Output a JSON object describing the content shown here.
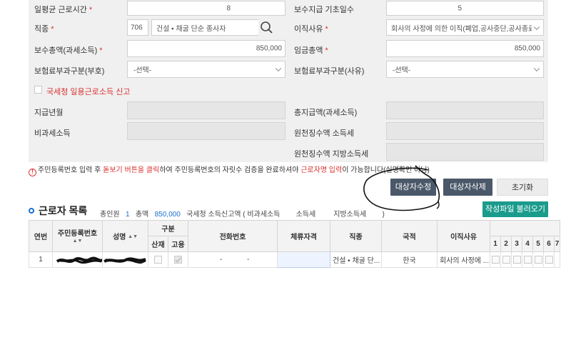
{
  "form": {
    "daily_hours": {
      "label": "일평균 근로시간",
      "required": "*",
      "value": "8"
    },
    "pay_base_days": {
      "label": "보수지급 기초일수",
      "value": "5"
    },
    "job_type": {
      "label": "직종",
      "required": "*",
      "code": "706",
      "name": "건설 • 채굴 단순 종사자"
    },
    "leave_reason": {
      "label": "이직사유",
      "required": "*",
      "value": "회사의 사정에 의한 이직(폐업,공사중단,공사종료"
    },
    "total_pay": {
      "label": "보수총액(과세소득)",
      "required": "*",
      "value": "850,000"
    },
    "total_wage": {
      "label": "임금총액",
      "required": "*",
      "value": "850,000"
    },
    "insurance_charge_type": {
      "label": "보험료부과구분(부호)",
      "value": "-선택-"
    },
    "insurance_charge_reason": {
      "label": "보험료부과구분(사유)",
      "value": "-선택-"
    },
    "nts_report": {
      "label": "국세청 일용근로소득 신고"
    },
    "pay_month": {
      "label": "지급년월"
    },
    "total_payment": {
      "label": "총지급액(과세소득)"
    },
    "nontaxable": {
      "label": "비과세소득"
    },
    "withholding_income_tax": {
      "label": "원천징수액 소득세"
    },
    "withholding_local_tax": {
      "label": "원천징수액 지방소득세"
    }
  },
  "notice": {
    "part1": "주민등록번호 입력 후 ",
    "part2": "돋보기 버튼을 클릭",
    "part3": "하여 주민등록번호의 자릿수 검증을 완료하셔야 ",
    "part4": "근로자명 입력",
    "part5": "이 가능합니다(실명확인 아님)"
  },
  "buttons": {
    "edit_target": "대상자수정",
    "delete_target": "대상자삭제",
    "reset": "초기화",
    "load_file": "작성파일 불러오기"
  },
  "list": {
    "title": "근로자 목록",
    "total_label": "총인원",
    "total_count": "1",
    "amount_label": "총액",
    "amount": "850,000",
    "nts_label": "국세청 소득신고액 ( 비과세소득",
    "income_tax_label": "소득세",
    "local_tax_label": "지방소득세",
    "close_paren": ")"
  },
  "table": {
    "headers": {
      "no": "연번",
      "rrn": "주민등록번호",
      "name": "성명",
      "category": "구분",
      "accident": "산재",
      "employment": "고용",
      "phone": "전화번호",
      "residence": "체류자격",
      "job": "직종",
      "nationality": "국적",
      "leave_reason": "이직사유",
      "days": [
        "1",
        "2",
        "3",
        "4",
        "5",
        "6",
        "7"
      ]
    },
    "rows": [
      {
        "no": "1",
        "phone_sep1": "-",
        "phone_sep2": "-",
        "job": "건설 • 채굴 단...",
        "nationality": "한국",
        "leave_reason": "회사의 사정에 ..."
      }
    ]
  }
}
